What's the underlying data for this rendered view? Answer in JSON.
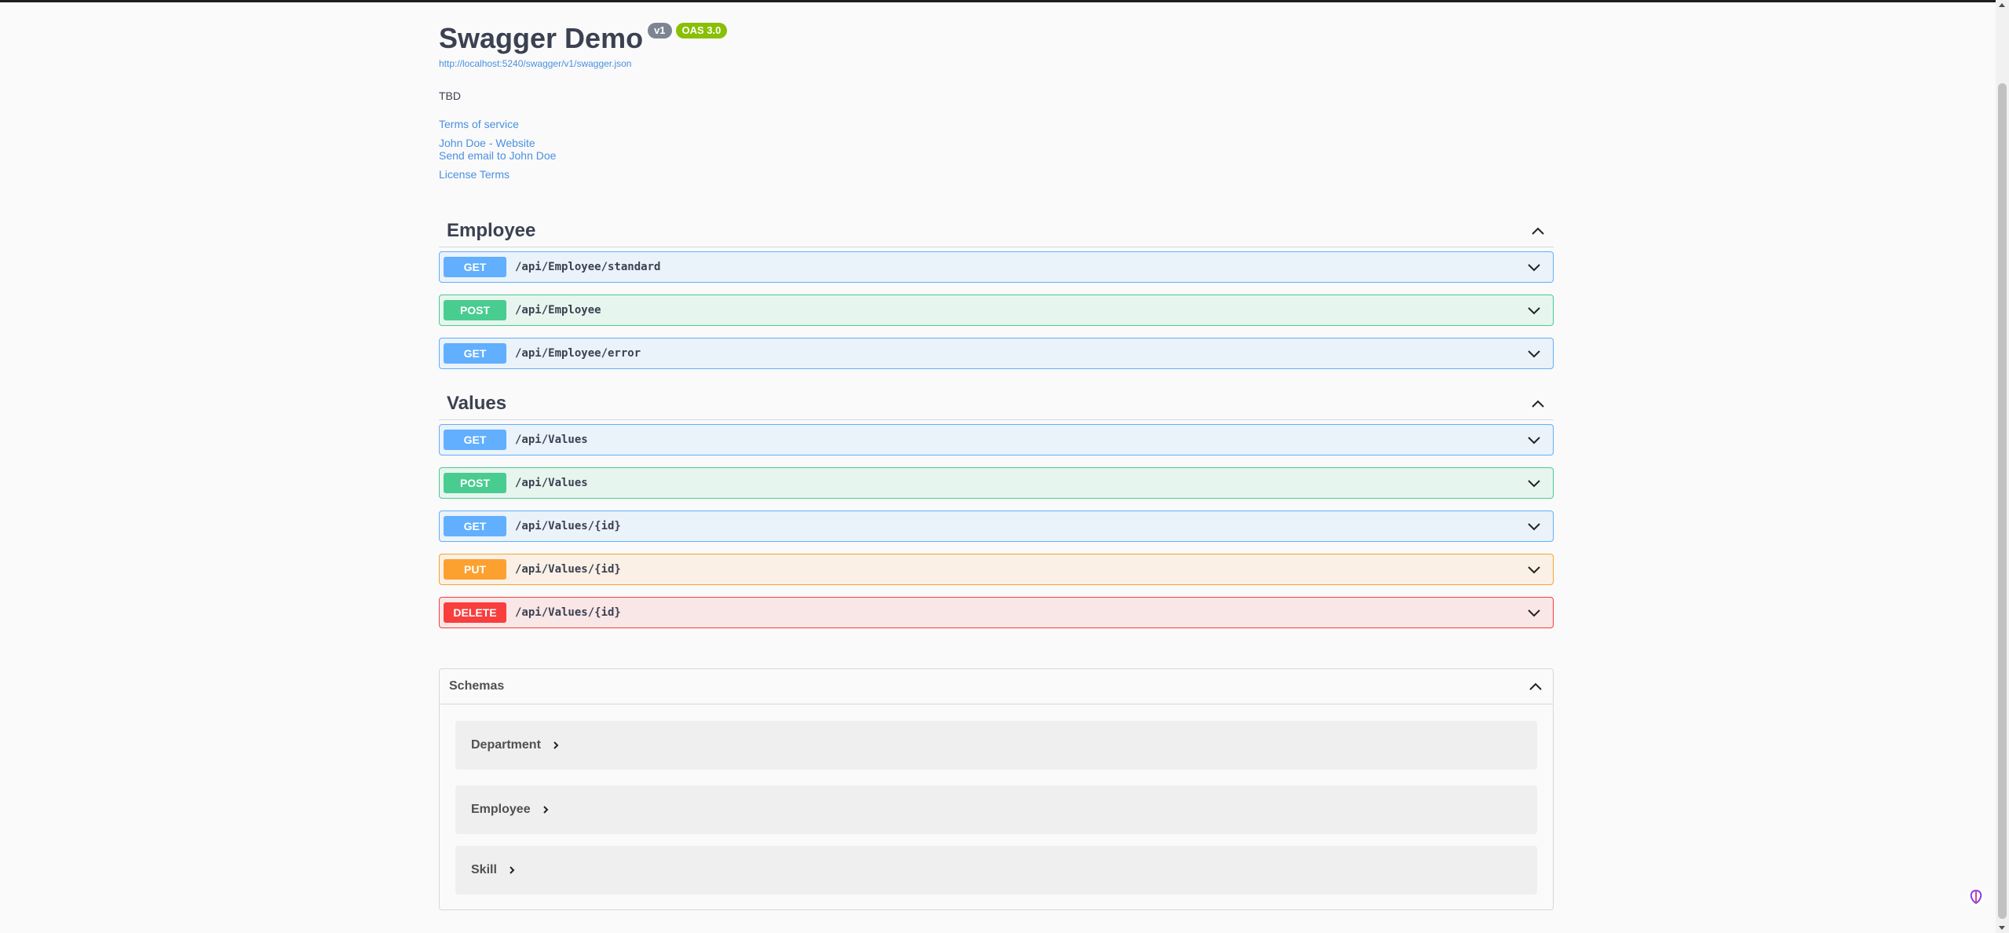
{
  "info": {
    "title": "Swagger Demo",
    "version_badge": "v1",
    "oas_badge": "OAS 3.0",
    "spec_url": "http://localhost:5240/swagger/v1/swagger.json",
    "description": "TBD",
    "terms_of_service": "Terms of service",
    "contact_website": "John Doe - Website",
    "contact_email": "Send email to John Doe",
    "license": "License Terms"
  },
  "tags": [
    {
      "name": "Employee",
      "operations": [
        {
          "method": "GET",
          "path": "/api/Employee/standard"
        },
        {
          "method": "POST",
          "path": "/api/Employee"
        },
        {
          "method": "GET",
          "path": "/api/Employee/error"
        }
      ]
    },
    {
      "name": "Values",
      "operations": [
        {
          "method": "GET",
          "path": "/api/Values"
        },
        {
          "method": "POST",
          "path": "/api/Values"
        },
        {
          "method": "GET",
          "path": "/api/Values/{id}"
        },
        {
          "method": "PUT",
          "path": "/api/Values/{id}"
        },
        {
          "method": "DELETE",
          "path": "/api/Values/{id}"
        }
      ]
    }
  ],
  "schemas": {
    "title": "Schemas",
    "models": [
      "Department",
      "Employee",
      "Skill"
    ]
  },
  "colors": {
    "get": "#61affe",
    "post": "#49cc90",
    "put": "#fca130",
    "delete": "#f93e3e",
    "link": "#4990e2"
  }
}
